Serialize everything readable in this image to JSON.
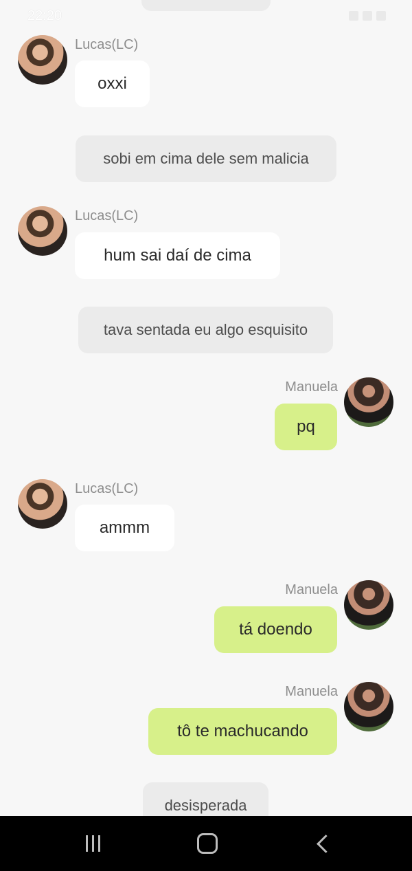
{
  "status_bar": {
    "time": "22:20"
  },
  "messages": [
    {
      "type": "received",
      "sender": "Lucas(LC)",
      "text": "oxxi"
    },
    {
      "type": "narration",
      "text": "sobi em cima dele sem malicia"
    },
    {
      "type": "received",
      "sender": "Lucas(LC)",
      "text": "hum sai daí de cima"
    },
    {
      "type": "narration",
      "text": "tava sentada eu algo esquisito"
    },
    {
      "type": "sent",
      "sender": "Manuela",
      "text": "pq"
    },
    {
      "type": "received",
      "sender": "Lucas(LC)",
      "text": "ammm"
    },
    {
      "type": "sent",
      "sender": "Manuela",
      "text": "tá doendo"
    },
    {
      "type": "sent",
      "sender": "Manuela",
      "text": "tô te machucando"
    },
    {
      "type": "narration",
      "text": "desisperada"
    }
  ],
  "colors": {
    "sent_bubble": "#d7f08a",
    "received_bubble": "#ffffff",
    "narration_bubble": "#ebebeb",
    "background": "#f7f7f7"
  },
  "nav": {
    "recents": "recents-icon",
    "home": "home-icon",
    "back": "back-icon"
  }
}
